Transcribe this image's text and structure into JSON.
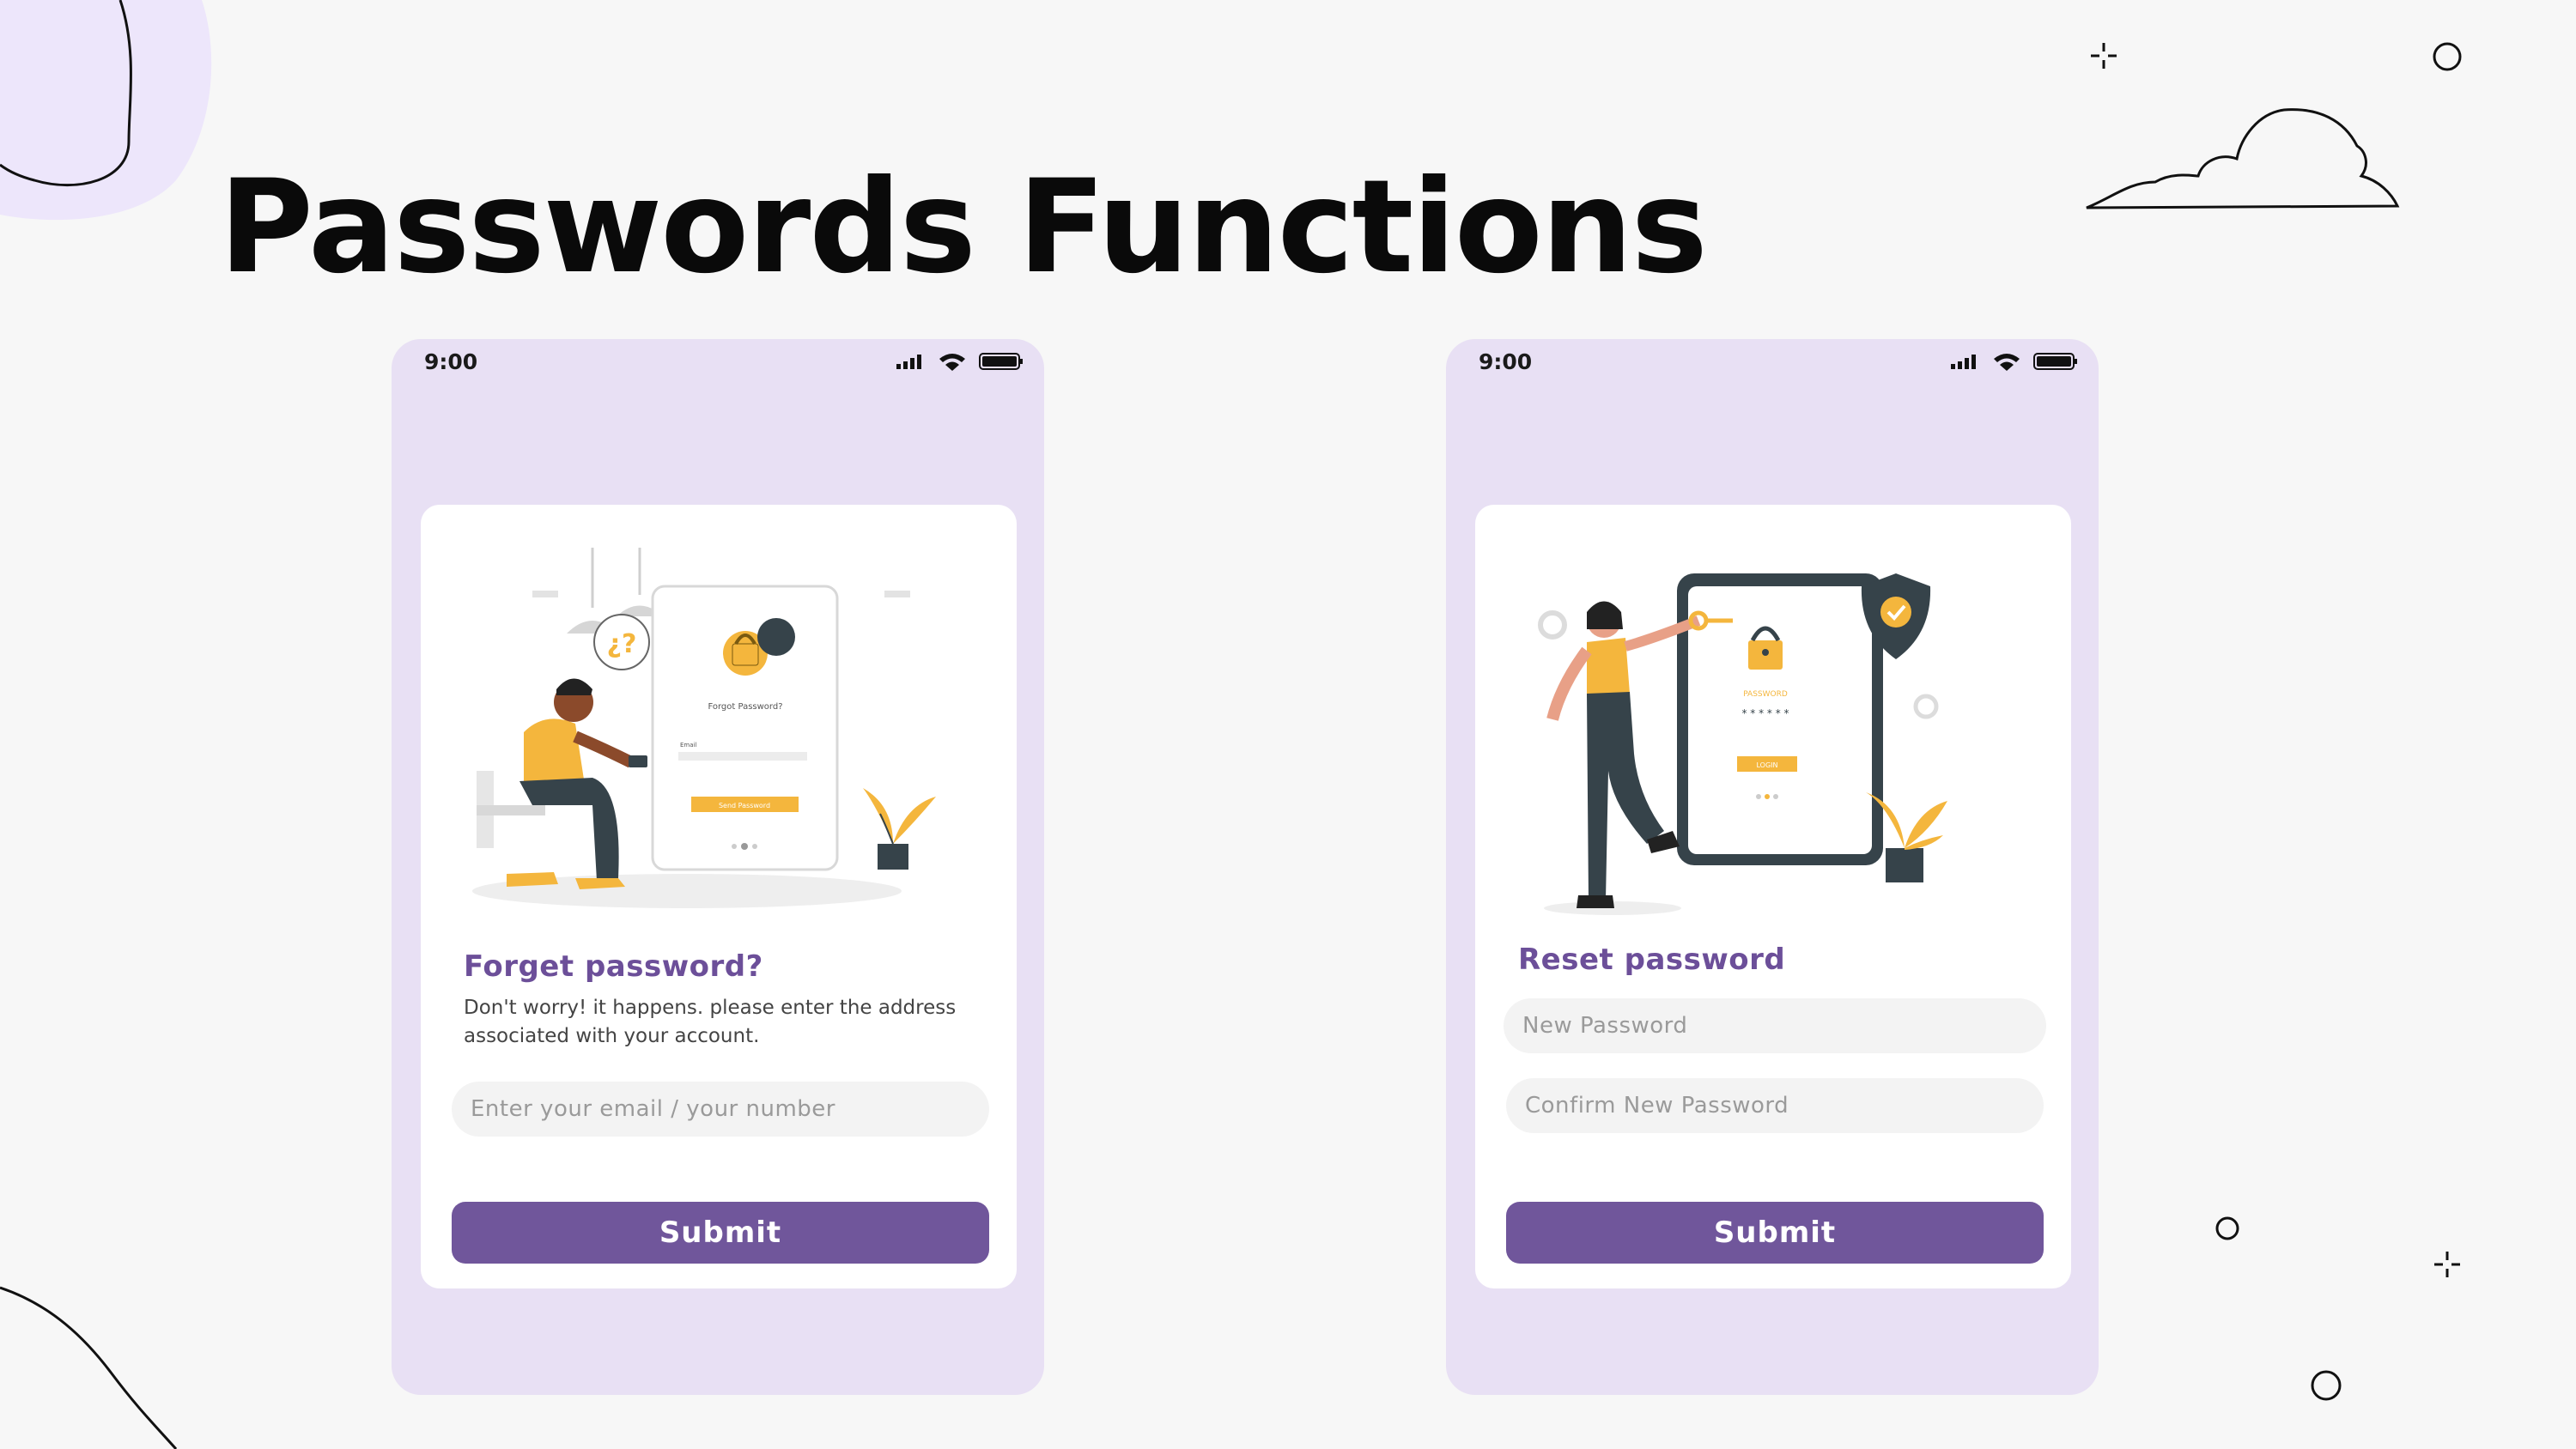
{
  "title": "Passwords Functions",
  "screens": [
    {
      "status": {
        "time": "9:00",
        "icons": [
          "signal-icon",
          "wifi-icon",
          "battery-icon"
        ]
      },
      "illustration": {
        "name": "forgot-password-illustration",
        "bubble": "¿?",
        "phone_heading": "Forgot Password?",
        "phone_field_label": "Email",
        "phone_button": "Send Password"
      },
      "heading": "Forget password?",
      "description": "Don't worry! it happens. please enter the address associated with your account.",
      "fields": [
        {
          "placeholder": "Enter your email / your number"
        }
      ],
      "submit_label": "Submit"
    },
    {
      "status": {
        "time": "9:00",
        "icons": [
          "signal-icon",
          "wifi-icon",
          "battery-icon"
        ]
      },
      "illustration": {
        "name": "reset-password-illustration",
        "phone_label": "PASSWORD",
        "phone_button": "LOGIN"
      },
      "heading": "Reset password",
      "fields": [
        {
          "placeholder": "New Password"
        },
        {
          "placeholder": "Confirm New Password"
        }
      ],
      "submit_label": "Submit"
    }
  ],
  "colors": {
    "background": "#f7f7f7",
    "phone_bg": "#e8e0f4",
    "card_bg": "#ffffff",
    "accent_purple": "#70569b",
    "heading_purple": "#6c4f99",
    "illustration_yellow": "#f4b63d",
    "illustration_dark": "#36434a",
    "blob": "#ede6fb"
  }
}
